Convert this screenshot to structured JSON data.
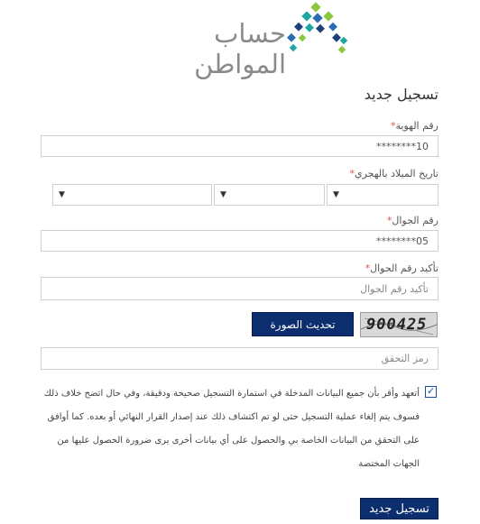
{
  "logo": {
    "text": "حساب المواطن"
  },
  "page_title": "تسجيل جديد",
  "fields": {
    "national_id": {
      "label": "رقم الهوية",
      "value": "10********"
    },
    "birth_date": {
      "label": "تاريخ الميلاد بالهجري",
      "day_arrow": "▼",
      "month_arrow": "▼",
      "year_arrow": "▼"
    },
    "mobile": {
      "label": "رقم الجوال",
      "value": "05********"
    },
    "confirm_mobile": {
      "label": "تأكيد رقم الجوال",
      "placeholder": "تأكيد رقم الجوال"
    },
    "captcha_code": {
      "placeholder": "رمز التحقق"
    }
  },
  "required_mark": "*",
  "captcha": {
    "image_text": "900425",
    "refresh_label": "تحديث الصورة"
  },
  "terms": {
    "checked": true,
    "check_glyph": "✓",
    "text": "أتعهد وأقر بأن جميع البيانات المدخلة في استمارة التسجيل صحيحة ودقيقة، وفي حال اتضح خلاف ذلك فسوف يتم إلغاء عملية التسجيل حتى لو تم اكتشاف ذلك عند إصدار القرار النهائي أو بعده. كما أوافق على التحقق من البيانات الخاصة بي والحصول على أي بيانات أخرى يرى ضرورة الحصول عليها من الجهات المختصة"
  },
  "submit_label": "تسجيل جديد",
  "colors": {
    "primary": "#0d2e6e",
    "required": "#d9534f"
  }
}
